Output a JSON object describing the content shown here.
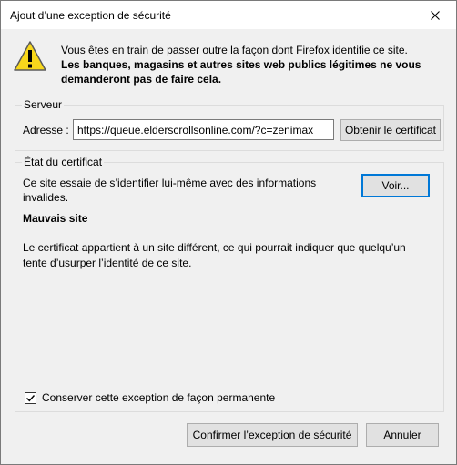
{
  "window": {
    "title": "Ajout d’une exception de sécurité",
    "close_icon": "close-icon"
  },
  "intro": {
    "icon": "warning-icon",
    "line1": "Vous êtes en train de passer outre la façon dont Firefox identifie ce site.",
    "line2": "Les banques, magasins et autres sites web publics légitimes ne vous demanderont pas de faire cela."
  },
  "server": {
    "group_label": "Serveur",
    "address_label": "Adresse :",
    "address_value": "https://queue.elderscrollsonline.com/?c=zenimax",
    "get_cert_button": "Obtenir le certificat"
  },
  "certificate": {
    "group_label": "État du certificat",
    "description": "Ce site essaie de s’identifier lui-même avec des informations invalides.",
    "view_button": "Voir...",
    "status_title": "Mauvais site",
    "status_detail": "Le certificat appartient à un site différent, ce qui pourrait indiquer que quelqu’un tente d’usurper l’identité de ce site."
  },
  "permanent": {
    "label": "Conserver cette exception de façon permanente",
    "checked": true
  },
  "buttons": {
    "confirm": "Confirmer l’exception de sécurité",
    "cancel": "Annuler"
  },
  "colors": {
    "warning_yellow": "#f8d81c",
    "focus_blue": "#0078d7",
    "dialog_background": "#f0f0f0"
  }
}
